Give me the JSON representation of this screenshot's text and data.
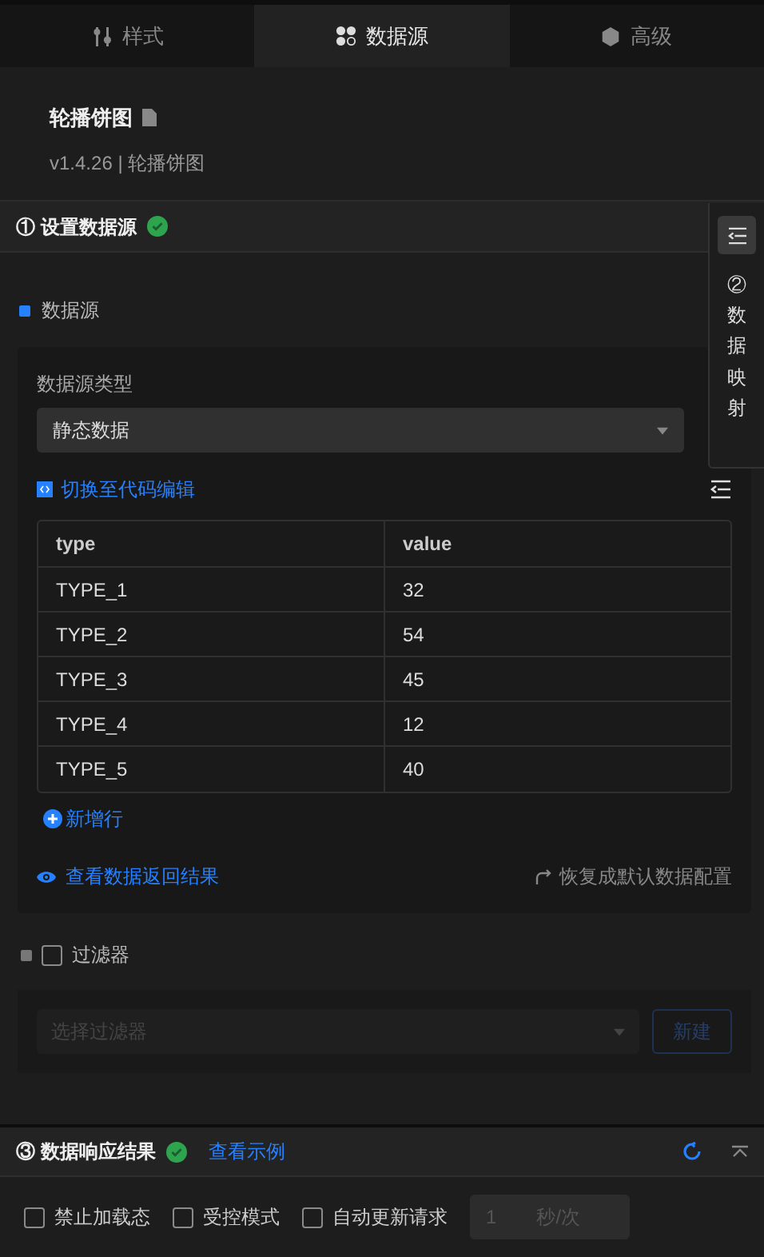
{
  "tabs": [
    {
      "label": "样式",
      "selected": false
    },
    {
      "label": "数据源",
      "selected": true
    },
    {
      "label": "高级",
      "selected": false
    }
  ],
  "component": {
    "title": "轮播饼图",
    "version": "v1.4.26 | 轮播饼图"
  },
  "section1": {
    "title": "① 设置数据源",
    "ok": true
  },
  "side_panel": {
    "label": "②数据映射"
  },
  "datasource": {
    "label": "数据源",
    "type_label": "数据源类型",
    "type_value": "静态数据",
    "code_link": "切换至代码编辑",
    "table": {
      "columns": [
        "type",
        "value"
      ],
      "rows": [
        [
          "TYPE_1",
          "32"
        ],
        [
          "TYPE_2",
          "54"
        ],
        [
          "TYPE_3",
          "45"
        ],
        [
          "TYPE_4",
          "12"
        ],
        [
          "TYPE_5",
          "40"
        ]
      ]
    },
    "add_row": "新增行",
    "view_result": "查看数据返回结果",
    "restore": "恢复成默认数据配置"
  },
  "filter": {
    "label": "过滤器",
    "checked": false,
    "placeholder": "选择过滤器",
    "button": "新建"
  },
  "section3": {
    "title": "③ 数据响应结果",
    "ok": true,
    "example_link": "查看示例"
  },
  "options": [
    {
      "label": "禁止加载态",
      "checked": false
    },
    {
      "label": "受控模式",
      "checked": false
    },
    {
      "label": "自动更新请求",
      "checked": false
    }
  ],
  "interval": {
    "value": "1",
    "unit": "秒/次"
  }
}
